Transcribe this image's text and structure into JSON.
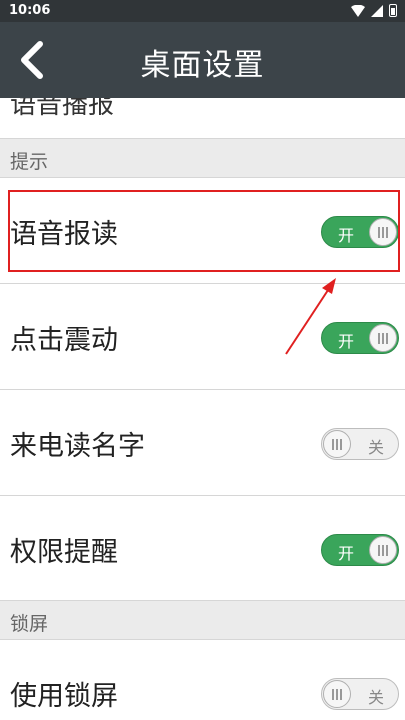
{
  "status_bar": {
    "time": "10:06"
  },
  "app_bar": {
    "title": "桌面设置"
  },
  "partial_row": {
    "label": "语音播报"
  },
  "sections": [
    {
      "header": "提示",
      "items": [
        {
          "label": "语音报读",
          "state": "on",
          "state_label": "开",
          "highlighted": true
        },
        {
          "label": "点击震动",
          "state": "on",
          "state_label": "开"
        },
        {
          "label": "来电读名字",
          "state": "off",
          "state_label": "关"
        },
        {
          "label": "权限提醒",
          "state": "on",
          "state_label": "开"
        }
      ]
    },
    {
      "header": "锁屏",
      "items": [
        {
          "label": "使用锁屏",
          "state": "off",
          "state_label": "关"
        }
      ]
    }
  ],
  "colors": {
    "app_bar": "#3c4449",
    "toggle_on": "#3aa55b",
    "highlight": "#e02020"
  }
}
